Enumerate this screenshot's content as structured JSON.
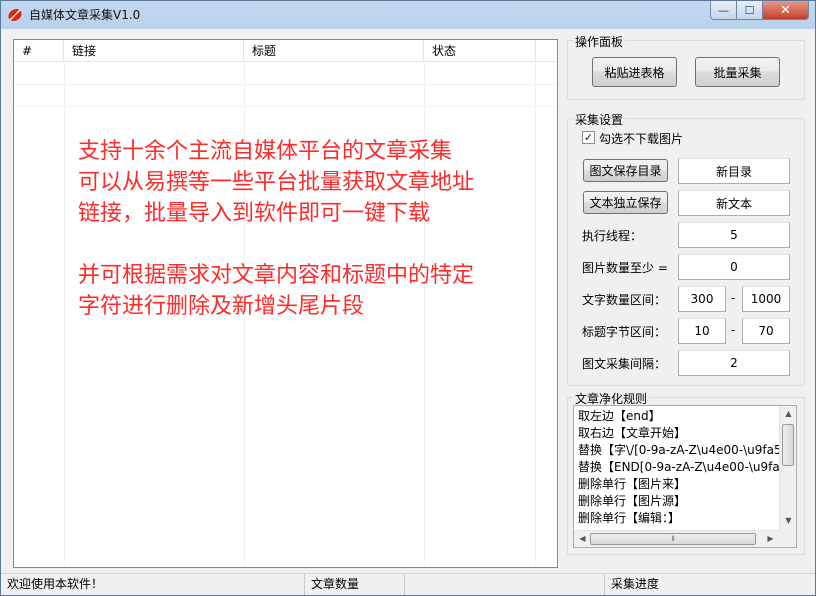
{
  "window": {
    "title": "自媒体文章采集V1.0",
    "minimize_glyph": "—",
    "maximize_glyph": "☐",
    "close_glyph": "✕",
    "icon": "leaf-icon"
  },
  "list": {
    "columns": [
      "#",
      "链接",
      "标题",
      "状态"
    ],
    "rows": []
  },
  "promo_lines": [
    "支持十余个主流自媒体平台的文章采集",
    "可以从易撰等一些平台批量获取文章地址",
    "链接，批量导入到软件即可一键下载",
    "",
    "并可根据需求对文章内容和标题中的特定",
    "字符进行删除及新增头尾片段"
  ],
  "operation_panel": {
    "title": "操作面板",
    "paste_button": "粘贴进表格",
    "batch_button": "批量采集"
  },
  "settings": {
    "title": "采集设置",
    "no_images_checkbox": {
      "label": "勾选不下载图片",
      "checked": true,
      "glyph": "✓"
    },
    "image_dir_button": "图文保存目录",
    "image_dir_value": "新目录",
    "text_save_button": "文本独立保存",
    "text_save_value": "新文本",
    "threads_label": "执行线程：",
    "threads_value": "5",
    "min_images_label": "图片数量至少 =",
    "min_images_value": "0",
    "word_range_label": "文字数量区间：",
    "word_min": "300",
    "word_max": "1000",
    "title_range_label": "标题字节区间：",
    "title_min": "10",
    "title_max": "70",
    "interval_label": "图文采集间隔：",
    "interval_value": "2",
    "range_sep": "-"
  },
  "rules": {
    "title": "文章净化规则",
    "items": [
      "取左边【end】",
      "取右边【文章开始】",
      "替换【字\\/[0-9a-zA-Z\\u4e00-\\u9fa5",
      "替换【END[0-9a-zA-Z\\u4e00-\\u9fa",
      "删除单行【图片来】",
      "删除单行【图片源】",
      "删除单行【编辑：】"
    ],
    "scroll_up": "▲",
    "scroll_down": "▼",
    "scroll_left": "◀",
    "scroll_right": "▶",
    "grip": "⦀"
  },
  "statusbar": {
    "welcome": "欢迎使用本软件！",
    "article_count_label": "文章数量",
    "progress_label": "采集进度"
  }
}
